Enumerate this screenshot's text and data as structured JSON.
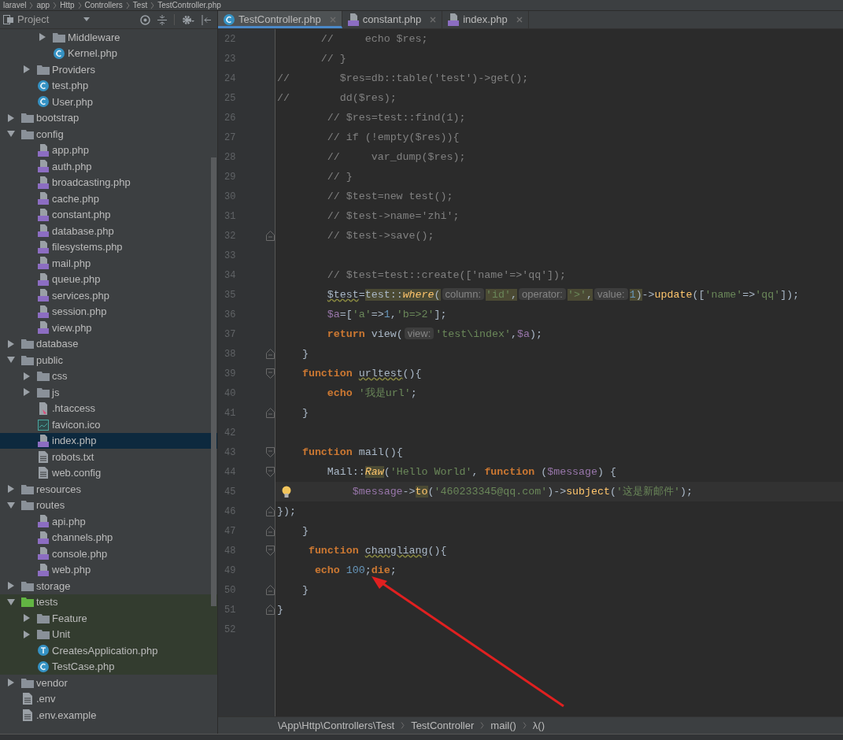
{
  "breadcrumb": [
    "laravel",
    "app",
    "Http",
    "Controllers",
    "Test",
    "TestController.php"
  ],
  "project_panel": {
    "title": "Project"
  },
  "tree": [
    {
      "kind": "group",
      "children": [
        {
          "kind": "group",
          "children": [
            {
              "kind": "folder",
              "label": "Middleware",
              "expanded": false,
              "selected": false
            },
            {
              "kind": "class",
              "label": "Kernel.php",
              "selected": false
            }
          ]
        },
        {
          "kind": "folder",
          "label": "Providers",
          "expanded": false,
          "selected": false
        },
        {
          "kind": "class",
          "label": "test.php",
          "selected": false
        },
        {
          "kind": "class",
          "label": "User.php",
          "selected": false
        }
      ]
    },
    {
      "kind": "folder",
      "label": "bootstrap",
      "expanded": false,
      "selected": false
    },
    {
      "kind": "folder",
      "label": "config",
      "expanded": true,
      "selected": false,
      "children": [
        {
          "kind": "php",
          "label": "app.php",
          "selected": false
        },
        {
          "kind": "php",
          "label": "auth.php",
          "selected": false
        },
        {
          "kind": "php",
          "label": "broadcasting.php",
          "selected": false
        },
        {
          "kind": "php",
          "label": "cache.php",
          "selected": false
        },
        {
          "kind": "php",
          "label": "constant.php",
          "selected": false
        },
        {
          "kind": "php",
          "label": "database.php",
          "selected": false
        },
        {
          "kind": "php",
          "label": "filesystems.php",
          "selected": false
        },
        {
          "kind": "php",
          "label": "mail.php",
          "selected": false
        },
        {
          "kind": "php",
          "label": "queue.php",
          "selected": false
        },
        {
          "kind": "php",
          "label": "services.php",
          "selected": false
        },
        {
          "kind": "php",
          "label": "session.php",
          "selected": false
        },
        {
          "kind": "php",
          "label": "view.php",
          "selected": false
        }
      ]
    },
    {
      "kind": "folder",
      "label": "database",
      "expanded": false,
      "selected": false
    },
    {
      "kind": "folder",
      "label": "public",
      "expanded": true,
      "selected": false,
      "children": [
        {
          "kind": "folder",
          "label": "css",
          "expanded": false,
          "selected": false
        },
        {
          "kind": "folder",
          "label": "js",
          "expanded": false,
          "selected": false
        },
        {
          "kind": "htaccess",
          "label": ".htaccess",
          "selected": false
        },
        {
          "kind": "image",
          "label": "favicon.ico",
          "selected": false
        },
        {
          "kind": "php",
          "label": "index.php",
          "selected": true
        },
        {
          "kind": "text",
          "label": "robots.txt",
          "selected": false
        },
        {
          "kind": "text",
          "label": "web.config",
          "selected": false
        }
      ]
    },
    {
      "kind": "folder",
      "label": "resources",
      "expanded": false,
      "selected": false
    },
    {
      "kind": "folder",
      "label": "routes",
      "expanded": true,
      "selected": false,
      "children": [
        {
          "kind": "php",
          "label": "api.php",
          "selected": false
        },
        {
          "kind": "php",
          "label": "channels.php",
          "selected": false
        },
        {
          "kind": "php",
          "label": "console.php",
          "selected": false
        },
        {
          "kind": "php",
          "label": "web.php",
          "selected": false
        }
      ]
    },
    {
      "kind": "folder",
      "label": "storage",
      "expanded": false,
      "selected": false
    },
    {
      "kind": "test_folder",
      "label": "tests",
      "expanded": true,
      "selected": false,
      "children": [
        {
          "kind": "folder",
          "label": "Feature",
          "expanded": false,
          "selected": false
        },
        {
          "kind": "folder",
          "label": "Unit",
          "expanded": false,
          "selected": false
        },
        {
          "kind": "trait",
          "label": "CreatesApplication.php",
          "selected": false
        },
        {
          "kind": "class",
          "label": "TestCase.php",
          "selected": false
        }
      ]
    },
    {
      "kind": "folder",
      "label": "vendor",
      "expanded": false,
      "selected": false
    },
    {
      "kind": "text",
      "label": ".env",
      "selected": false
    },
    {
      "kind": "text",
      "label": ".env.example",
      "selected": false
    }
  ],
  "tabs": [
    {
      "kind": "class",
      "label": "TestController.php",
      "selected": true
    },
    {
      "kind": "php",
      "label": "constant.php",
      "selected": false
    },
    {
      "kind": "php",
      "label": "index.php",
      "selected": false
    }
  ],
  "code_lines": [
    {
      "number": "22",
      "tokens": [
        {
          "kind": "comment",
          "text": "       //     echo $res;"
        }
      ]
    },
    {
      "number": "23",
      "tokens": [
        {
          "kind": "comment",
          "text": "       // }"
        }
      ]
    },
    {
      "number": "24",
      "tokens": [
        {
          "kind": "comment",
          "text": "//        $res=db::table('test')->get();"
        }
      ]
    },
    {
      "number": "25",
      "tokens": [
        {
          "kind": "comment",
          "text": "//        dd($res);"
        }
      ]
    },
    {
      "number": "26",
      "tokens": [
        {
          "kind": "comment",
          "text": "        // $res=test::find(1);"
        }
      ]
    },
    {
      "number": "27",
      "tokens": [
        {
          "kind": "comment",
          "text": "        // if (!empty($res)){"
        }
      ]
    },
    {
      "number": "28",
      "tokens": [
        {
          "kind": "comment",
          "text": "        //     var_dump($res);"
        }
      ]
    },
    {
      "number": "29",
      "tokens": [
        {
          "kind": "comment",
          "text": "        // }"
        }
      ]
    },
    {
      "number": "30",
      "tokens": [
        {
          "kind": "comment",
          "text": "        // $test=new test();"
        }
      ]
    },
    {
      "number": "31",
      "tokens": [
        {
          "kind": "comment",
          "text": "        // $test->name='zhi';"
        }
      ]
    },
    {
      "number": "32",
      "fold_end": true,
      "tokens": [
        {
          "kind": "comment",
          "text": "        // $test->save();"
        }
      ]
    },
    {
      "number": "33"
    },
    {
      "number": "34",
      "tokens": [
        {
          "kind": "comment",
          "text": "        // $test=test::create(['name'=>'qq']);"
        }
      ]
    },
    {
      "number": "35",
      "tokens": [
        {
          "kind": "warn",
          "text": "        $test"
        },
        {
          "kind": "plain",
          "text": "="
        },
        {
          "kind": "plain",
          "text": "test::",
          "highlight": true
        },
        {
          "kind": "static",
          "text": "where",
          "highlight": true
        },
        {
          "kind": "plain",
          "text": "(",
          "highlight": true
        },
        {
          "kind": "hint",
          "text": "column:"
        },
        {
          "kind": "string",
          "text": "'id'",
          "highlight": true
        },
        {
          "kind": "plain",
          "text": ",",
          "highlight": true
        },
        {
          "kind": "hint",
          "text": "operator:"
        },
        {
          "kind": "string",
          "text": "'>'",
          "highlight": true
        },
        {
          "kind": "plain",
          "text": ",",
          "highlight": true
        },
        {
          "kind": "hint",
          "text": "value:"
        },
        {
          "kind": "number",
          "text": "1",
          "highlight": true
        },
        {
          "kind": "plain",
          "text": ")",
          "highlight": true
        },
        {
          "kind": "plain",
          "text": "->"
        },
        {
          "kind": "method",
          "text": "update"
        },
        {
          "kind": "plain",
          "text": "(["
        },
        {
          "kind": "string",
          "text": "'name'"
        },
        {
          "kind": "plain",
          "text": "=>"
        },
        {
          "kind": "string",
          "text": "'qq'"
        },
        {
          "kind": "plain",
          "text": "]);"
        }
      ]
    },
    {
      "number": "36",
      "tokens": [
        {
          "kind": "var",
          "text": "        $a"
        },
        {
          "kind": "plain",
          "text": "=["
        },
        {
          "kind": "string",
          "text": "'a'"
        },
        {
          "kind": "plain",
          "text": "=>"
        },
        {
          "kind": "number",
          "text": "1"
        },
        {
          "kind": "plain",
          "text": ","
        },
        {
          "kind": "string",
          "text": "'b=>2'"
        },
        {
          "kind": "plain",
          "text": "];"
        }
      ]
    },
    {
      "number": "37",
      "tokens": [
        {
          "kind": "keyword",
          "text": "        return"
        },
        {
          "kind": "plain",
          "text": " view("
        },
        {
          "kind": "hint",
          "text": "view:"
        },
        {
          "kind": "string",
          "text": "'test\\index'"
        },
        {
          "kind": "plain",
          "text": ","
        },
        {
          "kind": "var",
          "text": "$a"
        },
        {
          "kind": "plain",
          "text": ");"
        }
      ]
    },
    {
      "number": "38",
      "fold_end": true,
      "tokens": [
        {
          "kind": "plain",
          "text": "    }"
        }
      ]
    },
    {
      "number": "39",
      "fold_start": true,
      "tokens": [
        {
          "kind": "keyword",
          "text": "    function "
        },
        {
          "kind": "warn",
          "text": "urltest"
        },
        {
          "kind": "plain",
          "text": "(){"
        }
      ]
    },
    {
      "number": "40",
      "tokens": [
        {
          "kind": "keyword",
          "text": "        echo "
        },
        {
          "kind": "string",
          "text": "'我是url'"
        },
        {
          "kind": "plain",
          "text": ";"
        }
      ]
    },
    {
      "number": "41",
      "fold_end": true,
      "tokens": [
        {
          "kind": "plain",
          "text": "    }"
        }
      ]
    },
    {
      "number": "42"
    },
    {
      "number": "43",
      "fold_start": true,
      "tokens": [
        {
          "kind": "keyword",
          "text": "    function"
        },
        {
          "kind": "plain",
          "text": " mail(){"
        }
      ]
    },
    {
      "number": "44",
      "fold_start": true,
      "tokens": [
        {
          "kind": "plain",
          "text": "        Mail::"
        },
        {
          "kind": "static",
          "text": "Raw",
          "highlight": true
        },
        {
          "kind": "plain",
          "text": "("
        },
        {
          "kind": "string",
          "text": "'Hello World'"
        },
        {
          "kind": "plain",
          "text": ", "
        },
        {
          "kind": "keyword",
          "text": "function"
        },
        {
          "kind": "plain",
          "text": " ("
        },
        {
          "kind": "var",
          "text": "$message"
        },
        {
          "kind": "plain",
          "text": ") {"
        }
      ]
    },
    {
      "number": "45",
      "current": true,
      "tokens": [
        {
          "kind": "var",
          "text": "            $message"
        },
        {
          "kind": "plain",
          "text": "->"
        },
        {
          "kind": "method",
          "text": "to",
          "highlight": true
        },
        {
          "kind": "plain",
          "text": "("
        },
        {
          "kind": "string",
          "text": "'460233345@qq.com'"
        },
        {
          "kind": "plain",
          "text": ")->"
        },
        {
          "kind": "method",
          "text": "subject"
        },
        {
          "kind": "plain",
          "text": "("
        },
        {
          "kind": "string",
          "text": "'这是新邮件'"
        },
        {
          "kind": "plain",
          "text": ");"
        }
      ]
    },
    {
      "number": "46",
      "fold_end": true,
      "tokens": [
        {
          "kind": "plain",
          "text": "});"
        }
      ]
    },
    {
      "number": "47",
      "fold_end": true,
      "tokens": [
        {
          "kind": "plain",
          "text": "    }"
        }
      ]
    },
    {
      "number": "48",
      "fold_start": true,
      "tokens": [
        {
          "kind": "keyword",
          "text": "     function "
        },
        {
          "kind": "warn",
          "text": "changliang"
        },
        {
          "kind": "plain",
          "text": "(){"
        }
      ]
    },
    {
      "number": "49",
      "tokens": [
        {
          "kind": "keyword",
          "text": "      echo "
        },
        {
          "kind": "number",
          "text": "100"
        },
        {
          "kind": "plain",
          "text": ";"
        },
        {
          "kind": "keyword",
          "text": "die"
        },
        {
          "kind": "plain",
          "text": ";"
        }
      ]
    },
    {
      "number": "50",
      "fold_end": true,
      "tokens": [
        {
          "kind": "plain",
          "text": "    }"
        }
      ]
    },
    {
      "number": "51",
      "fold_end": true,
      "tokens": [
        {
          "kind": "plain",
          "text": "}"
        }
      ]
    },
    {
      "number": "52"
    }
  ],
  "navigation_bar": [
    "\\App\\Http\\Controllers\\Test",
    "TestController",
    "mail()",
    "λ()"
  ]
}
